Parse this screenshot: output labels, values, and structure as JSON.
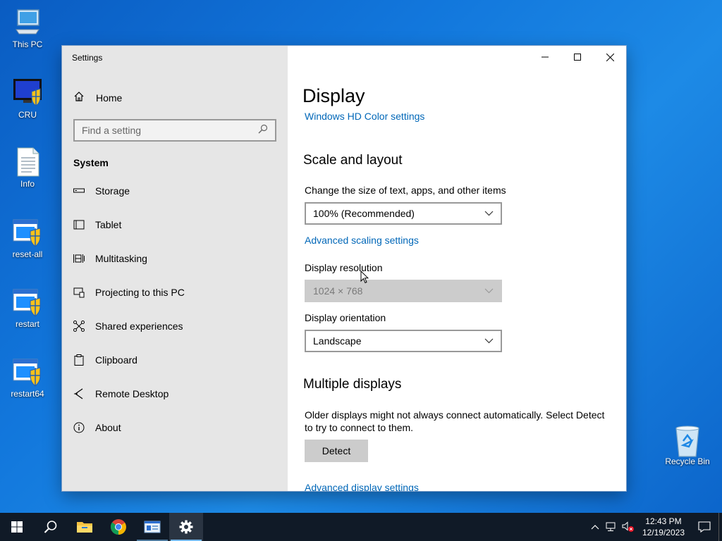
{
  "desktop": {
    "icons": [
      {
        "label": "This PC",
        "icon": "computer-icon"
      },
      {
        "label": "CRU",
        "icon": "monitor-shield-icon"
      },
      {
        "label": "Info",
        "icon": "document-icon"
      },
      {
        "label": "reset-all",
        "icon": "shield-app-icon"
      },
      {
        "label": "restart",
        "icon": "shield-app-icon"
      },
      {
        "label": "restart64",
        "icon": "shield-app-icon"
      },
      {
        "label": "Recycle Bin",
        "icon": "recycle-bin-icon"
      }
    ]
  },
  "window": {
    "title": "Settings",
    "sidebar": {
      "home_label": "Home",
      "search_placeholder": "Find a setting",
      "section": "System",
      "items": [
        {
          "label": "Storage",
          "icon": "storage-icon"
        },
        {
          "label": "Tablet",
          "icon": "tablet-icon"
        },
        {
          "label": "Multitasking",
          "icon": "multitasking-icon"
        },
        {
          "label": "Projecting to this PC",
          "icon": "projecting-icon"
        },
        {
          "label": "Shared experiences",
          "icon": "shared-experiences-icon"
        },
        {
          "label": "Clipboard",
          "icon": "clipboard-icon"
        },
        {
          "label": "Remote Desktop",
          "icon": "remote-desktop-icon"
        },
        {
          "label": "About",
          "icon": "info-icon"
        }
      ]
    },
    "content": {
      "title": "Display",
      "hd_color_link": "Windows HD Color settings",
      "scale_heading": "Scale and layout",
      "scale_label": "Change the size of text, apps, and other items",
      "scale_value": "100% (Recommended)",
      "advanced_scaling_link": "Advanced scaling settings",
      "resolution_label": "Display resolution",
      "resolution_value": "1024 × 768",
      "orientation_label": "Display orientation",
      "orientation_value": "Landscape",
      "multiple_heading": "Multiple displays",
      "multiple_text": "Older displays might not always connect automatically. Select Detect to try to connect to them.",
      "detect_button": "Detect",
      "advanced_display_link": "Advanced display settings"
    }
  },
  "taskbar": {
    "time": "12:43 PM",
    "date": "12/19/2023",
    "accent": "#76b9ed"
  }
}
